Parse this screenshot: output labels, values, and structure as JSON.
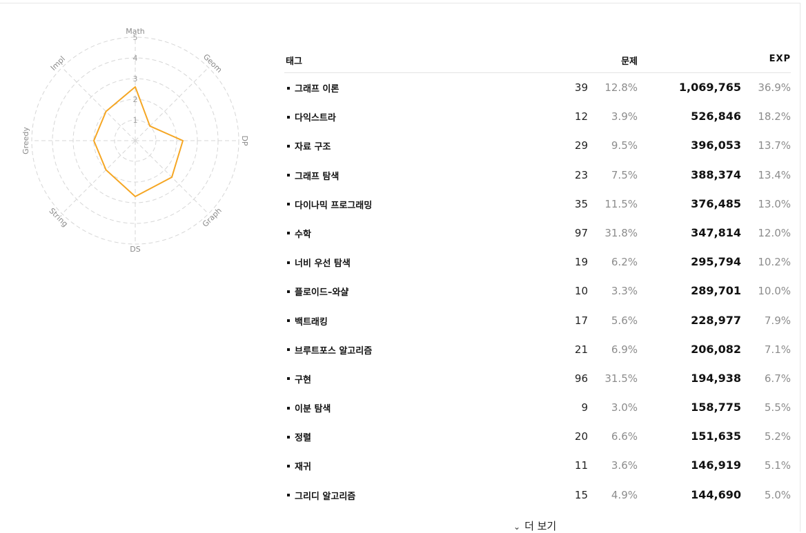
{
  "radar": {
    "axes": [
      "Math",
      "Geom",
      "DP",
      "Graph",
      "DS",
      "String",
      "Greedy",
      "Impl"
    ],
    "values": [
      2.6,
      1.0,
      2.3,
      2.5,
      2.7,
      2.0,
      2.0,
      2.0
    ],
    "max": 5,
    "ticks": [
      "1",
      "2",
      "3",
      "4",
      "5"
    ],
    "line_color": "#f5a623",
    "grid_color": "#d6d6d6"
  },
  "table": {
    "headers": {
      "tag": "태그",
      "problems": "문제",
      "exp": "EXP"
    },
    "rows": [
      {
        "name": "그래프 이론",
        "count": "39",
        "count_pct": "12.8%",
        "exp": "1,069,765",
        "exp_pct": "36.9%"
      },
      {
        "name": "다익스트라",
        "count": "12",
        "count_pct": "3.9%",
        "exp": "526,846",
        "exp_pct": "18.2%"
      },
      {
        "name": "자료 구조",
        "count": "29",
        "count_pct": "9.5%",
        "exp": "396,053",
        "exp_pct": "13.7%"
      },
      {
        "name": "그래프 탐색",
        "count": "23",
        "count_pct": "7.5%",
        "exp": "388,374",
        "exp_pct": "13.4%"
      },
      {
        "name": "다이나믹 프로그래밍",
        "count": "35",
        "count_pct": "11.5%",
        "exp": "376,485",
        "exp_pct": "13.0%"
      },
      {
        "name": "수학",
        "count": "97",
        "count_pct": "31.8%",
        "exp": "347,814",
        "exp_pct": "12.0%"
      },
      {
        "name": "너비 우선 탐색",
        "count": "19",
        "count_pct": "6.2%",
        "exp": "295,794",
        "exp_pct": "10.2%"
      },
      {
        "name": "플로이드–와샬",
        "count": "10",
        "count_pct": "3.3%",
        "exp": "289,701",
        "exp_pct": "10.0%"
      },
      {
        "name": "백트래킹",
        "count": "17",
        "count_pct": "5.6%",
        "exp": "228,977",
        "exp_pct": "7.9%"
      },
      {
        "name": "브루트포스 알고리즘",
        "count": "21",
        "count_pct": "6.9%",
        "exp": "206,082",
        "exp_pct": "7.1%"
      },
      {
        "name": "구현",
        "count": "96",
        "count_pct": "31.5%",
        "exp": "194,938",
        "exp_pct": "6.7%"
      },
      {
        "name": "이분 탐색",
        "count": "9",
        "count_pct": "3.0%",
        "exp": "158,775",
        "exp_pct": "5.5%"
      },
      {
        "name": "정렬",
        "count": "20",
        "count_pct": "6.6%",
        "exp": "151,635",
        "exp_pct": "5.2%"
      },
      {
        "name": "재귀",
        "count": "11",
        "count_pct": "3.6%",
        "exp": "146,919",
        "exp_pct": "5.1%"
      },
      {
        "name": "그리디 알고리즘",
        "count": "15",
        "count_pct": "4.9%",
        "exp": "144,690",
        "exp_pct": "5.0%"
      }
    ]
  },
  "more_button": {
    "label": "더 보기",
    "icon": "chevron-down-icon"
  }
}
